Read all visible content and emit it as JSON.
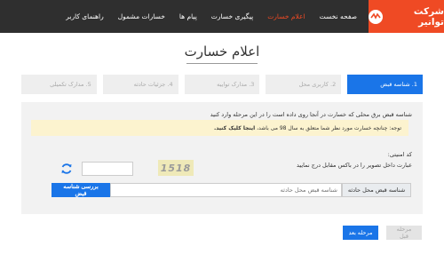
{
  "brand": {
    "name": "شرکت توانیر"
  },
  "nav": {
    "items": [
      {
        "label": "صفحه نخست"
      },
      {
        "label": "اعلام خسارت"
      },
      {
        "label": "پیگیری خسارت"
      },
      {
        "label": "پیام ها"
      },
      {
        "label": "خسارات مشمول"
      },
      {
        "label": "راهنمای کاربر"
      }
    ]
  },
  "page": {
    "title": "اعلام خسارت"
  },
  "steps": [
    {
      "label": "1. شناسه قبض"
    },
    {
      "label": "2. کاربری محل"
    },
    {
      "label": "3. مدارک تواییه"
    },
    {
      "label": "4. جزئیات حادثه"
    },
    {
      "label": "5. مدارک تکمیلی"
    }
  ],
  "form": {
    "description": "شناسه قبض برق محلی که خسارت در آنجا روی داده است را در این مرحله وارد کنید",
    "note_prefix": "توجه: چنانچه خسارت مورد نظر شما متعلق به سال 98 می باشد،",
    "note_link": "اینجا کلیک کنید.",
    "security_label": "کد امنیتی:",
    "security_desc": "عبارت داخل تصویر را در باکس مقابل درج نمایید",
    "captcha_text": "1518",
    "bill_addon": "شناسه قبض محل حادثه",
    "bill_placeholder": "شناسه قبض محل حادثه",
    "check_button": "بررسی شناسه قبض"
  },
  "buttons": {
    "next": "مرحله بعد",
    "prev": "مرحله قبل"
  },
  "colors": {
    "brand": "#ef4a24",
    "topbar": "#2f2f2f",
    "primary": "#1a75e8",
    "note_bg": "#fcf3cf"
  }
}
